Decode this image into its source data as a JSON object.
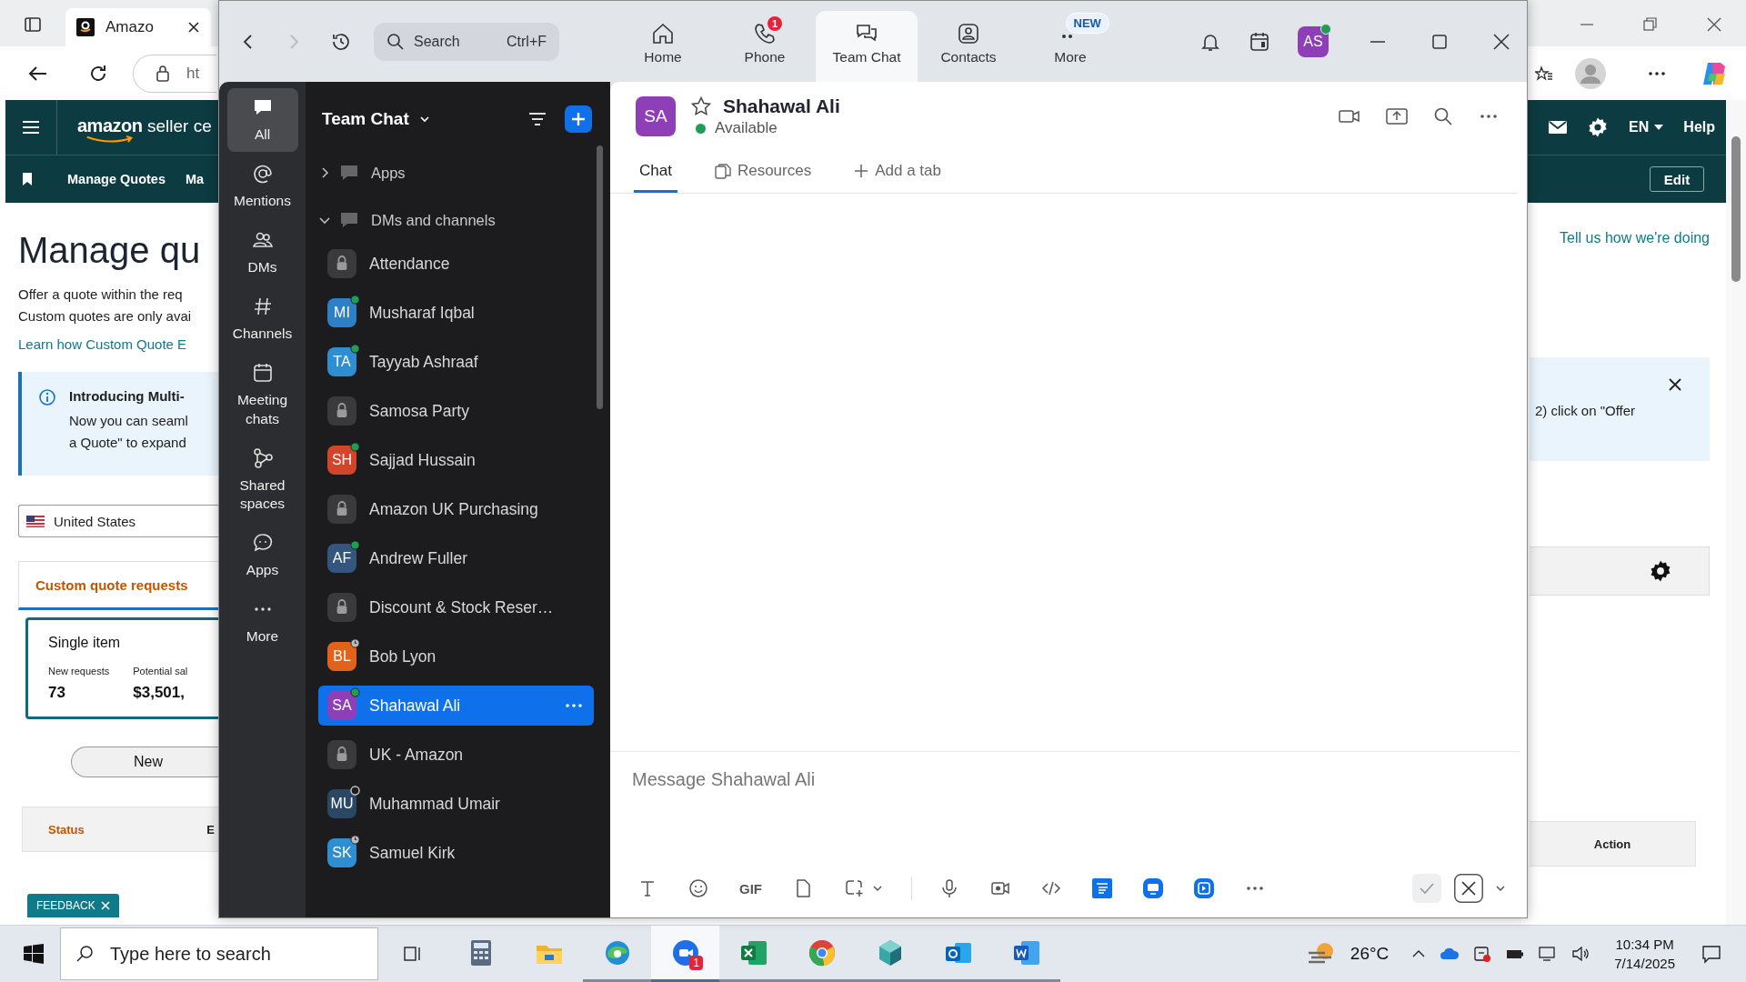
{
  "browser": {
    "tab": {
      "title": "Amazo"
    },
    "address": "ht"
  },
  "amazon": {
    "logo": {
      "brand": "amazon",
      "product": "seller ce"
    },
    "language": "EN",
    "help": "Help",
    "subnav": [
      "Manage Quotes",
      "Ma"
    ],
    "edit_button": "Edit",
    "heading": "Manage qu",
    "intro": [
      "Offer a quote within the req",
      "Custom quotes are only avai"
    ],
    "learn_link": "Learn how Custom Quote E",
    "feedback_link": "Tell us how we're doing",
    "banner": {
      "title": "Introducing Multi-",
      "lines": [
        "Now you can seaml",
        "a Quote\" to expand"
      ],
      "right_text": "2) click on \"Offer"
    },
    "country": "United States",
    "tab": "Custom quote requests",
    "card": {
      "title": "Single item",
      "stats": [
        {
          "label": "New requests",
          "value": "73"
        },
        {
          "label": "Potential sal",
          "value": "$3,501,"
        }
      ]
    },
    "new_button": "New",
    "table_columns": [
      "Status",
      "E",
      "Action"
    ],
    "feedback_badge": "FEEDBACK"
  },
  "zoom": {
    "search": {
      "placeholder": "Search",
      "shortcut": "Ctrl+F"
    },
    "nav": [
      {
        "label": "Home",
        "selected": false
      },
      {
        "label": "Phone",
        "selected": false,
        "badge": "1"
      },
      {
        "label": "Team Chat",
        "selected": true
      },
      {
        "label": "Contacts",
        "selected": false
      },
      {
        "label": "More",
        "selected": false,
        "badge": "NEW"
      }
    ],
    "user": {
      "initials": "AS",
      "color": "#8e3fb8",
      "online": true
    },
    "rail": [
      {
        "label": "All",
        "selected": true
      },
      {
        "label": "Mentions",
        "selected": false
      },
      {
        "label": "DMs",
        "selected": false
      },
      {
        "label": "Channels",
        "selected": false
      },
      {
        "label": "Meeting chats",
        "selected": false
      },
      {
        "label": "Shared spaces",
        "selected": false
      },
      {
        "label": "Apps",
        "selected": false
      },
      {
        "label": "More",
        "selected": false
      }
    ],
    "list": {
      "title": "Team Chat",
      "sections": [
        {
          "label": "Apps",
          "expanded": false
        },
        {
          "label": "DMs and channels",
          "expanded": true,
          "children": [
            {
              "kind": "channel",
              "name": "Attendance",
              "selected": false
            },
            {
              "kind": "person",
              "name": "Musharaf Iqbal",
              "initials": "MI",
              "color": "#2d7fc6",
              "online": true,
              "away": false,
              "selected": false
            },
            {
              "kind": "person",
              "name": "Tayyab Ashraaf",
              "initials": "TA",
              "color": "#2f8ed2",
              "online": true,
              "away": false,
              "selected": false
            },
            {
              "kind": "channel",
              "name": "Samosa Party",
              "selected": false
            },
            {
              "kind": "person",
              "name": "Sajjad Hussain",
              "initials": "SH",
              "color": "#d2452a",
              "online": true,
              "away": false,
              "selected": false
            },
            {
              "kind": "channel",
              "name": "Amazon UK Purchasing",
              "selected": false
            },
            {
              "kind": "person",
              "name": "Andrew Fuller",
              "initials": "AF",
              "color": "#34557e",
              "online": true,
              "away": false,
              "selected": false
            },
            {
              "kind": "channel",
              "name": "Discount & Stock Reser…",
              "selected": false
            },
            {
              "kind": "person",
              "name": "Bob Lyon",
              "initials": "BL",
              "color": "#e2621b",
              "online": false,
              "away": true,
              "selected": false
            },
            {
              "kind": "person",
              "name": "Shahawal Ali",
              "initials": "SA",
              "color": "#8e3fb8",
              "online": true,
              "away": false,
              "selected": true
            },
            {
              "kind": "channel",
              "name": "UK - Amazon",
              "selected": false
            },
            {
              "kind": "person",
              "name": "Muhammad Umair",
              "initials": "MU",
              "color": "#2a4766",
              "online": false,
              "away": false,
              "selected": false
            },
            {
              "kind": "person",
              "name": "Samuel Kirk",
              "initials": "SK",
              "color": "#2f8ed2",
              "online": false,
              "away": true,
              "selected": false
            }
          ]
        }
      ]
    },
    "chat": {
      "initials": "SA",
      "color": "#8e3fb8",
      "name": "Shahawal Ali",
      "starred": false,
      "online": true,
      "status": "Available",
      "tabs": [
        {
          "kind": "chat",
          "label": "Chat",
          "selected": true
        },
        {
          "kind": "files",
          "label": "Resources",
          "selected": false
        },
        {
          "kind": "add",
          "label": "Add a tab",
          "selected": false
        }
      ]
    },
    "composer": {
      "placeholder": "Message Shahawal Ali",
      "gif_label": "GIF"
    }
  },
  "taskbar": {
    "search_placeholder": "Type here to search",
    "apps": [
      {
        "running": false,
        "active": false
      },
      {
        "running": false,
        "active": false
      },
      {
        "running": true,
        "active": false
      },
      {
        "running": true,
        "active": true,
        "badge": "1"
      },
      {
        "running": true,
        "active": false
      },
      {
        "running": true,
        "active": false
      },
      {
        "running": true,
        "active": false
      },
      {
        "running": true,
        "active": false
      },
      {
        "running": true,
        "active": false
      }
    ],
    "weather": "26°C",
    "time": "10:34 PM",
    "date": "7/14/2025"
  }
}
